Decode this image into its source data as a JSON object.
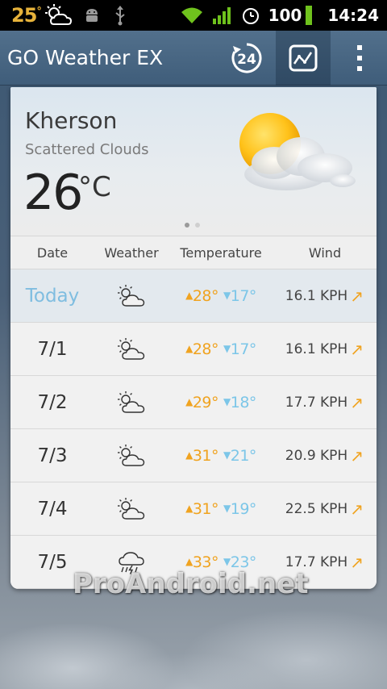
{
  "status_bar": {
    "temp": "25",
    "temp_unit": "°",
    "battery": "100",
    "time": "14:24",
    "icons": [
      "partly-cloudy-icon",
      "android-debug-icon",
      "usb-icon",
      "wifi-icon",
      "signal-icon",
      "alarm-icon",
      "battery-icon"
    ]
  },
  "app_bar": {
    "title": "GO Weather EX",
    "hours_button_label": "24",
    "icons": [
      "24-hour-forecast-icon",
      "trend-chart-icon",
      "overflow-menu-icon"
    ]
  },
  "current": {
    "city": "Kherson",
    "description": "Scattered Clouds",
    "temperature": "26",
    "unit": "°C",
    "page_count": 2,
    "active_page": 1
  },
  "forecast": {
    "headers": {
      "date": "Date",
      "weather": "Weather",
      "temperature": "Temperature",
      "wind": "Wind"
    },
    "rows": [
      {
        "date": "Today",
        "icon": "partly-cloudy-icon",
        "high": "28°",
        "low": "17°",
        "wind": "16.1 KPH"
      },
      {
        "date": "7/1",
        "icon": "partly-cloudy-icon",
        "high": "28°",
        "low": "17°",
        "wind": "16.1 KPH"
      },
      {
        "date": "7/2",
        "icon": "partly-cloudy-icon",
        "high": "29°",
        "low": "18°",
        "wind": "17.7 KPH"
      },
      {
        "date": "7/3",
        "icon": "partly-cloudy-icon",
        "high": "31°",
        "low": "21°",
        "wind": "20.9 KPH"
      },
      {
        "date": "7/4",
        "icon": "partly-cloudy-icon",
        "high": "31°",
        "low": "19°",
        "wind": "22.5 KPH"
      },
      {
        "date": "7/5",
        "icon": "thunderstorm-icon",
        "high": "33°",
        "low": "23°",
        "wind": "17.7 KPH"
      }
    ],
    "high_marker": "▲",
    "low_marker": "▼",
    "wind_arrow": "↗"
  },
  "colors": {
    "high": "#f0a320",
    "low": "#7cc6e8",
    "today": "#7fbde0",
    "app_bar": "#46647f"
  },
  "watermark": "ProAndroid.net"
}
